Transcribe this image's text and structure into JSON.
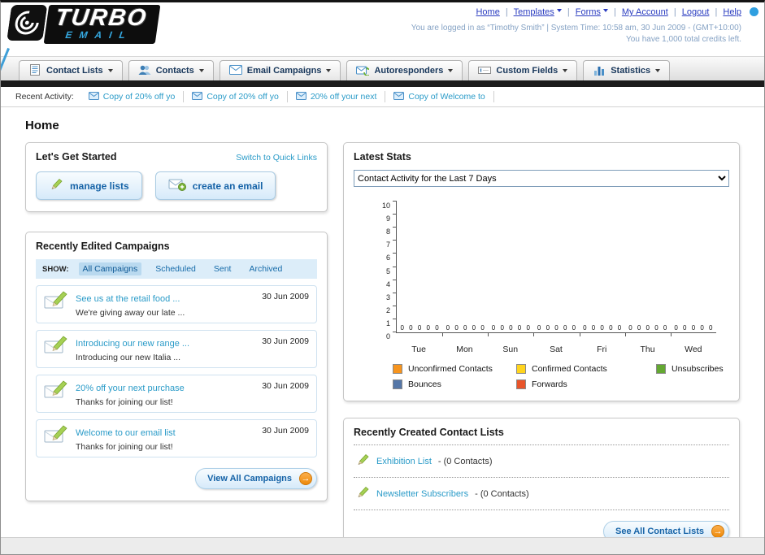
{
  "colors": {
    "brand_blue": "#35a8e0",
    "link_blue": "#2a3cc0",
    "teal_link": "#2a9bc8",
    "button_text_blue": "#1663a7",
    "nav_bar_black": "#1b1b1b",
    "orange_arrow": "#ee8a0a"
  },
  "icons": {
    "arrow_right": "→"
  },
  "header": {
    "logo_line1": "TURBO",
    "logo_line2": "EMAIL",
    "separator": "|",
    "nav_links": [
      {
        "label": "Home",
        "dropdown": false
      },
      {
        "label": "Templates",
        "dropdown": true
      },
      {
        "label": "Forms",
        "dropdown": true
      },
      {
        "label": "My Account",
        "dropdown": false
      },
      {
        "label": "Logout",
        "dropdown": false
      },
      {
        "label": "Help",
        "dropdown": false
      }
    ],
    "login_info": "You are logged in as “Timothy Smith” | System Time: 10:58 am, 30 Jun 2009 - (GMT+10:00)",
    "credits_info": "You have 1,000 total credits left."
  },
  "main_nav": {
    "items": [
      {
        "label": "Contact Lists"
      },
      {
        "label": "Contacts"
      },
      {
        "label": "Email Campaigns"
      },
      {
        "label": "Autoresponders"
      },
      {
        "label": "Custom Fields"
      },
      {
        "label": "Statistics"
      }
    ]
  },
  "recent_activity": {
    "label": "Recent Activity:",
    "items": [
      "Copy of 20% off yo",
      "Copy of 20% off yo",
      "20% off your next",
      "Copy of Welcome to"
    ]
  },
  "page": {
    "title": "Home"
  },
  "get_started": {
    "title": "Let's Get Started",
    "switch_link": "Switch to Quick Links",
    "manage_button": "manage lists",
    "create_button": "create an email"
  },
  "campaigns": {
    "title": "Recently Edited Campaigns",
    "show_label": "SHOW:",
    "tabs": [
      "All Campaigns",
      "Scheduled",
      "Sent",
      "Archived"
    ],
    "active_tab": "All Campaigns",
    "items": [
      {
        "title": "See us at the retail food ...",
        "subtitle": "We're giving away our late ...",
        "date": "30 Jun 2009"
      },
      {
        "title": "Introducing our new range ...",
        "subtitle": "Introducing our new Italia ...",
        "date": "30 Jun 2009"
      },
      {
        "title": "20% off your next purchase",
        "subtitle": "Thanks for joining our list!",
        "date": "30 Jun 2009"
      },
      {
        "title": "Welcome to our email list",
        "subtitle": "Thanks for joining our list!",
        "date": "30 Jun 2009"
      }
    ],
    "view_all_label": "View All Campaigns"
  },
  "latest_stats": {
    "title": "Latest Stats",
    "dropdown_value": "Contact Activity for the Last 7 Days",
    "chart_data": {
      "type": "bar",
      "title": "Contact Activity for the Last 7 Days",
      "categories": [
        "Tue",
        "Mon",
        "Sun",
        "Sat",
        "Fri",
        "Thu",
        "Wed"
      ],
      "series": [
        {
          "name": "Unconfirmed Contacts",
          "color": "#f7941d",
          "values": [
            0,
            0,
            0,
            0,
            0,
            0,
            0
          ]
        },
        {
          "name": "Confirmed Contacts",
          "color": "#ffd41d",
          "values": [
            0,
            0,
            0,
            0,
            0,
            0,
            0
          ]
        },
        {
          "name": "Unsubscribes",
          "color": "#64a832",
          "values": [
            0,
            0,
            0,
            0,
            0,
            0,
            0
          ]
        },
        {
          "name": "Bounces",
          "color": "#5577a8",
          "values": [
            0,
            0,
            0,
            0,
            0,
            0,
            0
          ]
        },
        {
          "name": "Forwards",
          "color": "#e8542a",
          "values": [
            0,
            0,
            0,
            0,
            0,
            0,
            0
          ]
        }
      ],
      "ylim": [
        0,
        10
      ],
      "ytick_step": 1,
      "grid": false,
      "legend_position": "bottom",
      "data_labels_shown": true
    }
  },
  "contact_lists": {
    "title": "Recently Created Contact Lists",
    "items": [
      {
        "name": "Exhibition List",
        "detail": "- (0 Contacts)"
      },
      {
        "name": "Newsletter Subscribers",
        "detail": "- (0 Contacts)"
      }
    ],
    "see_all_label": "See All Contact Lists"
  }
}
